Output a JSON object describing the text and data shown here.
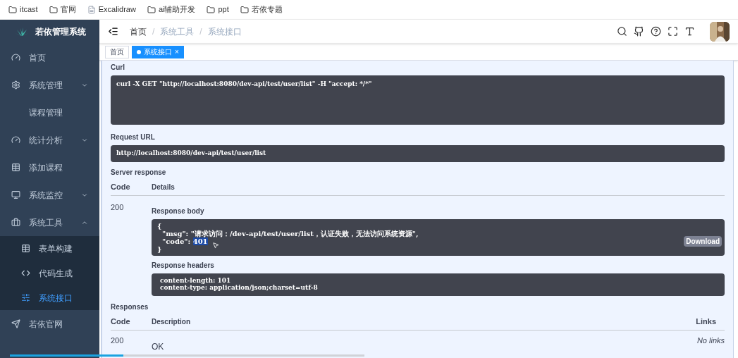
{
  "bookmarks": [
    {
      "label": "itcast",
      "kind": "folder"
    },
    {
      "label": "官网",
      "kind": "folder"
    },
    {
      "label": "Excalidraw",
      "kind": "page"
    },
    {
      "label": "ai辅助开发",
      "kind": "folder"
    },
    {
      "label": "ppt",
      "kind": "folder"
    },
    {
      "label": "若依专题",
      "kind": "folder"
    }
  ],
  "sidebar": {
    "title": "若依管理系统",
    "items": [
      {
        "label": "首页"
      },
      {
        "label": "系统管理",
        "expanded": false
      },
      {
        "label": "课程管理"
      },
      {
        "label": "统计分析",
        "expanded": false
      },
      {
        "label": "添加课程"
      },
      {
        "label": "系统监控",
        "expanded": false
      },
      {
        "label": "系统工具",
        "expanded": true,
        "children": [
          {
            "label": "表单构建",
            "selected": false
          },
          {
            "label": "代码生成",
            "selected": false
          },
          {
            "label": "系统接口",
            "selected": true
          }
        ]
      },
      {
        "label": "若依官网"
      }
    ]
  },
  "breadcrumb": [
    {
      "label": "首页",
      "current": false
    },
    {
      "label": "系统工具",
      "current": true
    },
    {
      "label": "系统接口",
      "current": true
    }
  ],
  "breadcrumb_separator": "/",
  "tabs": [
    {
      "label": "首页",
      "selected": false
    },
    {
      "label": "系统接口",
      "selected": true,
      "close": "×"
    }
  ],
  "curl": {
    "label": "Curl",
    "command": "curl -X GET \"http://localhost:8080/dev-api/test/user/list\" -H \"accept: */*\""
  },
  "request_url": {
    "label": "Request URL",
    "value": "http://localhost:8080/dev-api/test/user/list"
  },
  "server_response": {
    "label": "Server response",
    "columns": [
      "Code",
      "Details"
    ],
    "code": "200",
    "body_label": "Response body",
    "body_lines": [
      "{",
      "  \"msg\": \"请求访问：/dev-api/test/user/list，认证失败，无法访问系统资源\",",
      "  \"code\": ",
      "}"
    ],
    "highlighted": "401",
    "download": "Download",
    "headers_label": "Response headers",
    "headers": [
      "content-length: 101",
      "content-type: application/json;charset=utf-8"
    ]
  },
  "responses": {
    "label": "Responses",
    "columns": [
      "Code",
      "Description",
      "Links"
    ],
    "rows": [
      {
        "code": "200",
        "description": "OK",
        "links": "No links"
      }
    ]
  },
  "video_progress": {
    "level": 0.32
  }
}
